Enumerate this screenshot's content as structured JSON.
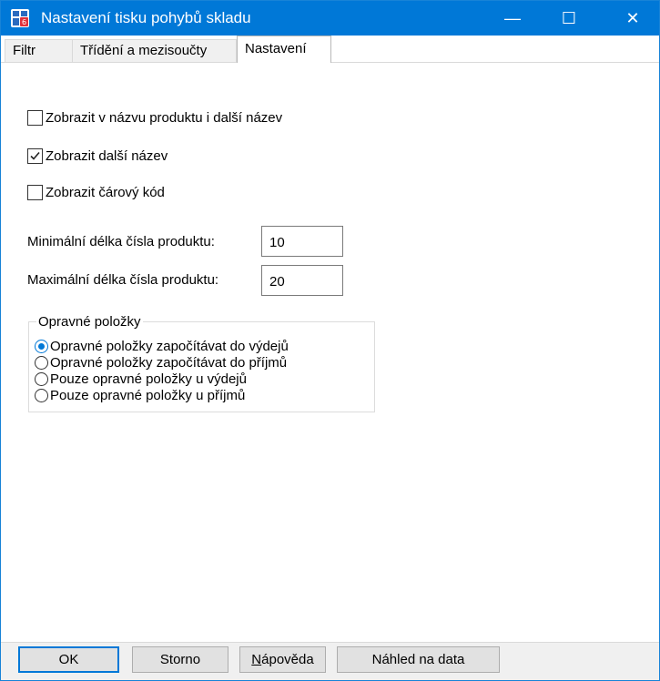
{
  "window": {
    "title": "Nastavení tisku pohybů skladu",
    "controls": {
      "minimize": "—",
      "maximize": "☐",
      "close": "✕"
    }
  },
  "tabs": [
    {
      "label": "Filtr",
      "active": false
    },
    {
      "label": "Třídění a mezisoučty",
      "active": false
    },
    {
      "label": "Nastavení",
      "active": true
    }
  ],
  "checkboxes": [
    {
      "label": "Zobrazit v názvu produktu i další název",
      "checked": false
    },
    {
      "label": "Zobrazit další název",
      "checked": true
    },
    {
      "label": "Zobrazit čárový kód",
      "checked": false
    }
  ],
  "fields": {
    "min_label": "Minimální délka čísla produktu:",
    "min_value": "10",
    "max_label": "Maximální délka čísla produktu:",
    "max_value": "20"
  },
  "group": {
    "title": "Opravné položky",
    "options": [
      {
        "label": "Opravné položky započítávat do výdejů",
        "selected": true
      },
      {
        "label": "Opravné položky započítávat do příjmů",
        "selected": false
      },
      {
        "label": "Pouze opravné položky u  výdejů",
        "selected": false
      },
      {
        "label": "Pouze opravné položky u  příjmů",
        "selected": false
      }
    ]
  },
  "buttons": {
    "ok": "OK",
    "cancel": "Storno",
    "help_first": "N",
    "help_rest": "ápověda",
    "preview": "Náhled na data"
  },
  "colors": {
    "accent": "#0078d7",
    "footer": "#f0f0f0"
  }
}
